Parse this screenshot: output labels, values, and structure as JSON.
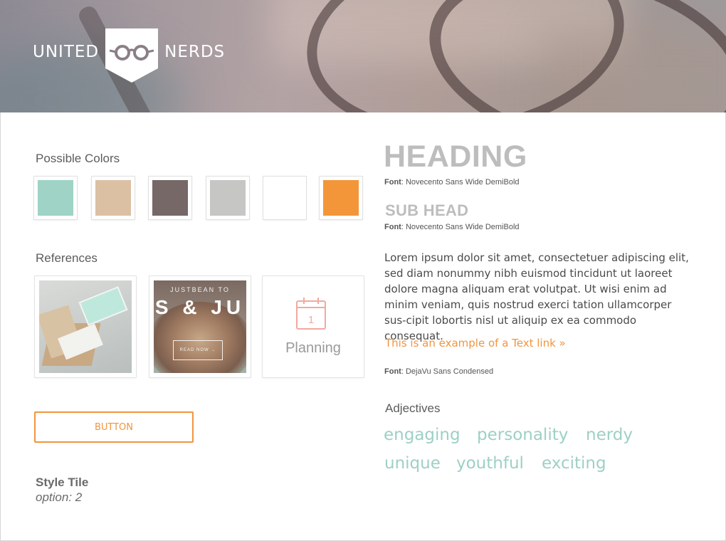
{
  "brand": {
    "left_word": "UNITED",
    "right_word": "NERDS",
    "shield_color": "#ffffff",
    "glasses_color": "#8a7f85"
  },
  "colors": {
    "title": "Possible Colors",
    "swatches": [
      "#9ed3c6",
      "#dcc0a4",
      "#756866",
      "#c6c6c4",
      "#ffffff",
      "#f39639"
    ]
  },
  "references": {
    "title": "References",
    "coffee_tagline": "JUSTBEAN TO",
    "coffee_headline": "S & JU",
    "coffee_button": "READ NOW →",
    "planning_day": "1",
    "planning_label": "Planning"
  },
  "button": {
    "label": "BUTTON"
  },
  "style_tile": {
    "title": "Style Tile",
    "option": "option: 2"
  },
  "typography": {
    "heading": "HEADING",
    "heading_font_key": "Font",
    "heading_font": ": Novecento Sans Wide DemiBold",
    "subhead": "SUB HEAD",
    "subhead_font_key": "Font",
    "subhead_font": ": Novecento Sans Wide DemiBold",
    "body": "Lorem ipsum dolor sit amet, consectetuer adipiscing elit, sed diam nonummy nibh euismod tincidunt ut laoreet dolore magna aliquam erat volutpat. Ut wisi enim ad minim veniam, quis nostrud exerci tation ullamcorper sus-cipit lobortis nisl ut aliquip ex ea commodo consequat.",
    "link": "This is an example of a Text link »",
    "body_font_key": "Font",
    "body_font": ": DejaVu Sans Condensed"
  },
  "adjectives": {
    "title": "Adjectives",
    "words": [
      "engaging",
      "personality",
      "nerdy",
      "unique",
      "youthful",
      "exciting"
    ]
  },
  "accent_color": "#f0953f",
  "adjective_color": "#9ed0c5"
}
